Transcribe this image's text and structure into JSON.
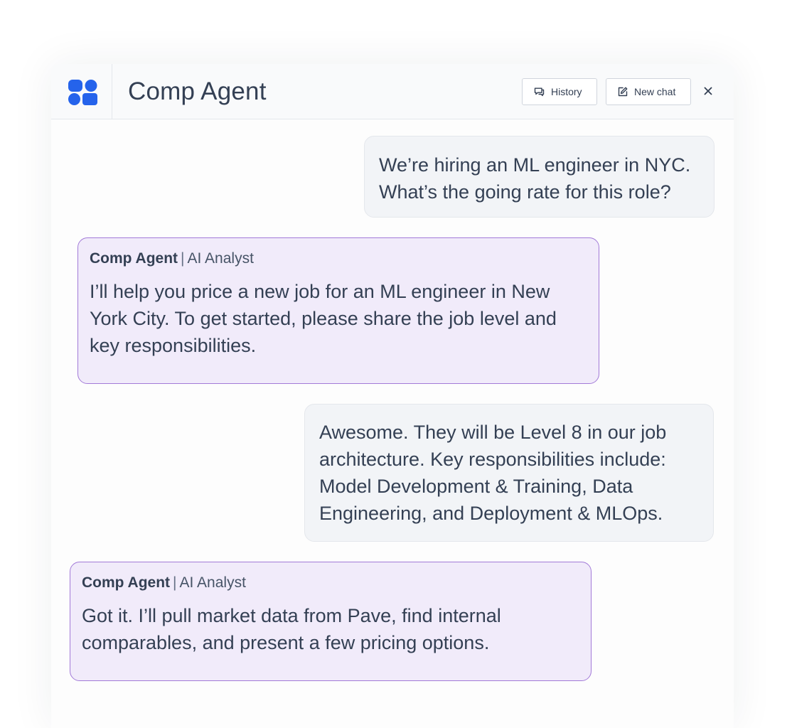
{
  "header": {
    "title": "Comp Agent",
    "history_label": "History",
    "new_chat_label": "New chat"
  },
  "colors": {
    "brand": "#2563eb",
    "agent_bubble": "#f1ebfa",
    "agent_border": "#a27ad8",
    "user_bubble": "#f2f4f7",
    "text": "#344054"
  },
  "icons": {
    "logo": "comp-agent-logo",
    "history": "speech-bubbles-icon",
    "new_chat": "edit-icon",
    "close": "close-icon"
  },
  "messages": [
    {
      "role": "user",
      "text": "We’re hiring an ML engineer in NYC. What’s the going rate for this role?"
    },
    {
      "role": "agent",
      "sender_name": "Comp Agent",
      "sender_sep": "|",
      "sender_role": "AI Analyst",
      "text": "I’ll help you price a new job for an ML engineer in New York City. To get started, please share the job level and key responsibilities."
    },
    {
      "role": "user",
      "text": "Awesome. They will be Level 8 in our job architecture. Key responsibilities include: Model Development & Training, Data Engineering, and Deployment & MLOps."
    },
    {
      "role": "agent",
      "sender_name": "Comp Agent",
      "sender_sep": "|",
      "sender_role": "AI Analyst",
      "text": "Got it. I’ll pull market data from Pave, find internal comparables, and present a few pricing options."
    }
  ]
}
